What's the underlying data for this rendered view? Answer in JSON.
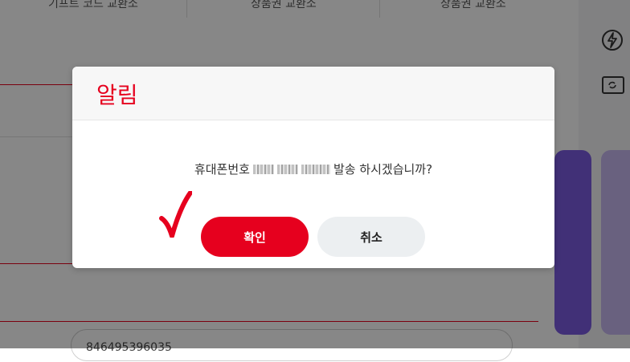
{
  "background": {
    "tabs": [
      "기프트 코드 교환소",
      "상품권 교환소",
      "상품권 교환소"
    ],
    "input_value": "846495396035",
    "side_icons": [
      "lightning-refresh-icon",
      "ticket-exchange-icon"
    ],
    "colors": {
      "card_purple": "#7b5be0",
      "card_lavender": "#c7b8f0",
      "accent_red": "#e6001e"
    }
  },
  "modal": {
    "title": "알림",
    "message_prefix": "휴대폰번호",
    "message_suffix": "발송 하시겠습니까?",
    "confirm_label": "확인",
    "cancel_label": "취소",
    "annotation_icon": "red-checkmark-icon"
  }
}
